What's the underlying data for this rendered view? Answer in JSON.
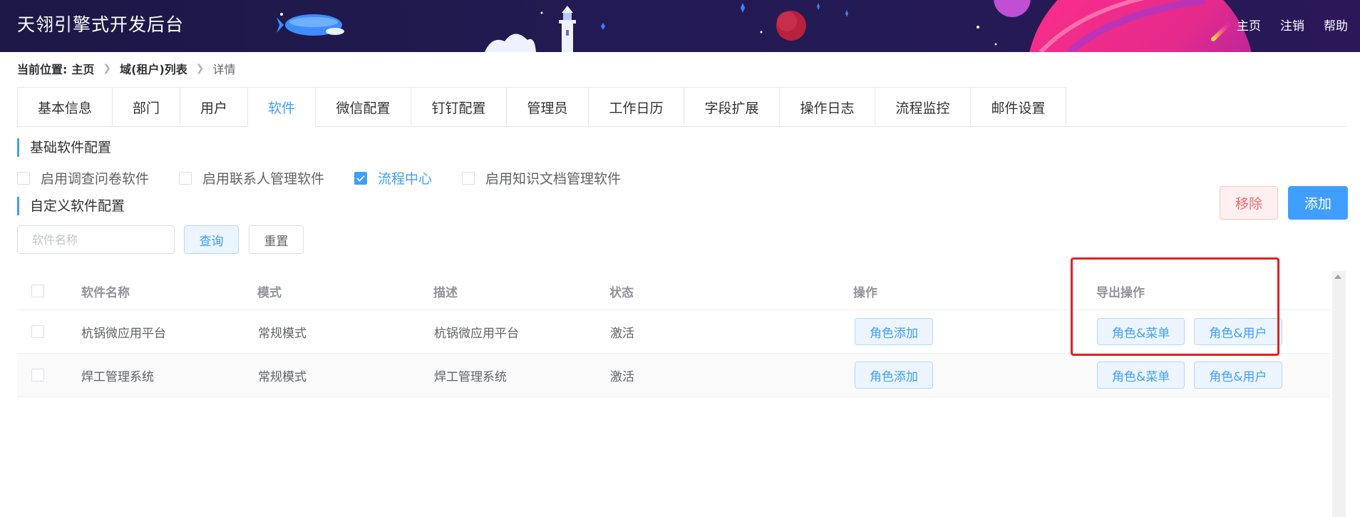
{
  "header": {
    "title": "天翎引擎式开发后台",
    "nav": [
      "主页",
      "注销",
      "帮助"
    ]
  },
  "breadcrumb": {
    "label": "当前位置:",
    "items": [
      "主页",
      "域(租户)列表",
      "详情"
    ]
  },
  "tabs": [
    "基本信息",
    "部门",
    "用户",
    "软件",
    "微信配置",
    "钉钉配置",
    "管理员",
    "工作日历",
    "字段扩展",
    "操作日志",
    "流程监控",
    "邮件设置"
  ],
  "active_tab": "软件",
  "basic_section": {
    "title": "基础软件配置",
    "options": [
      {
        "label": "启用调查问卷软件",
        "checked": false
      },
      {
        "label": "启用联系人管理软件",
        "checked": false
      },
      {
        "label": "流程中心",
        "checked": true
      },
      {
        "label": "启用知识文档管理软件",
        "checked": false
      }
    ]
  },
  "custom_section": {
    "title": "自定义软件配置",
    "remove_label": "移除",
    "add_label": "添加",
    "search_placeholder": "软件名称",
    "query_label": "查询",
    "reset_label": "重置"
  },
  "table": {
    "columns": [
      "软件名称",
      "模式",
      "描述",
      "状态",
      "操作",
      "导出操作"
    ],
    "rows": [
      {
        "name": "杭锅微应用平台",
        "mode": "常规模式",
        "desc": "杭锅微应用平台",
        "status": "激活",
        "action": "角色添加",
        "export1": "角色&菜单",
        "export2": "角色&用户"
      },
      {
        "name": "焊工管理系统",
        "mode": "常规模式",
        "desc": "焊工管理系统",
        "status": "激活",
        "action": "角色添加",
        "export1": "角色&菜单",
        "export2": "角色&用户"
      }
    ]
  },
  "colors": {
    "primary": "#409eff",
    "danger": "#f56c6c",
    "header_bg": "#1d1847",
    "highlight": "#ee1c25"
  }
}
